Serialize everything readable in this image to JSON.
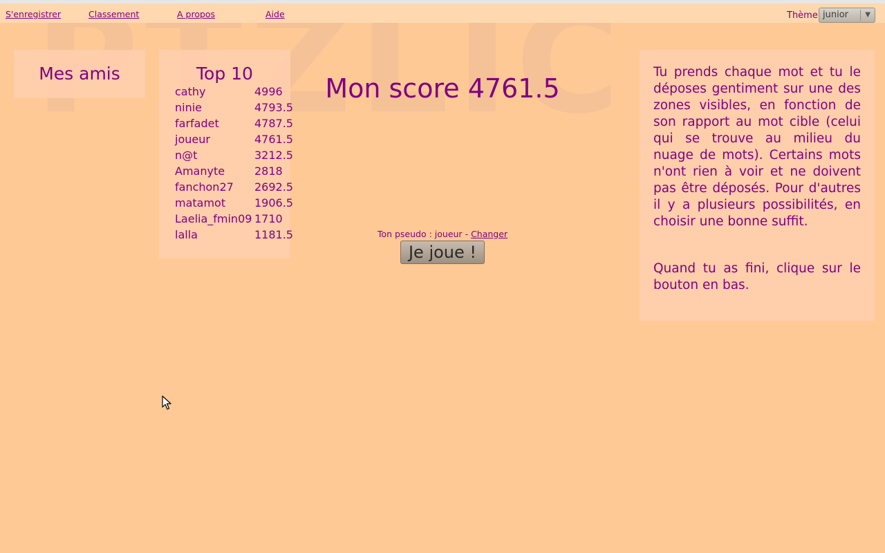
{
  "nav": {
    "register": "S'enregistrer",
    "ranking": "Classement",
    "about": "A propos",
    "help": "Aide"
  },
  "theme": {
    "label": "Thème",
    "value": "junior"
  },
  "friends": {
    "title": "Mes amis"
  },
  "top10": {
    "title": "Top 10",
    "rows": [
      {
        "name": "cathy",
        "score": "4996"
      },
      {
        "name": "ninie",
        "score": "4793.5"
      },
      {
        "name": "farfadet",
        "score": "4787.5"
      },
      {
        "name": "joueur",
        "score": "4761.5"
      },
      {
        "name": "n@t",
        "score": "3212.5"
      },
      {
        "name": "Amanyte",
        "score": "2818"
      },
      {
        "name": "fanchon27",
        "score": "2692.5"
      },
      {
        "name": "matamot",
        "score": "1906.5"
      },
      {
        "name": "Laelia_fmin09",
        "score": "1710"
      },
      {
        "name": "lalla",
        "score": "1181.5"
      }
    ]
  },
  "main": {
    "score_title": "Mon score 4761.5",
    "pseudo_label": "Ton pseudo : joueur",
    "separator": "-",
    "change_link": "Changer",
    "play_button": "Je joue !"
  },
  "watermark": "PTZLIC",
  "instructions": {
    "p1": "Tu prends chaque mot et tu le déposes gentiment sur une des zones visibles, en fonction de son rapport au mot cible (celui qui se trouve au milieu du nuage de mots). Certains mots n'ont rien à voir et ne doivent pas être déposés. Pour d'autres il y a plusieurs possibilités, en choisir une bonne suffit.",
    "p2": "Quand tu as fini, clique sur le bouton en bas."
  },
  "colors": {
    "background": "#ffc996",
    "text": "#800080",
    "panel": "#ffceac"
  }
}
